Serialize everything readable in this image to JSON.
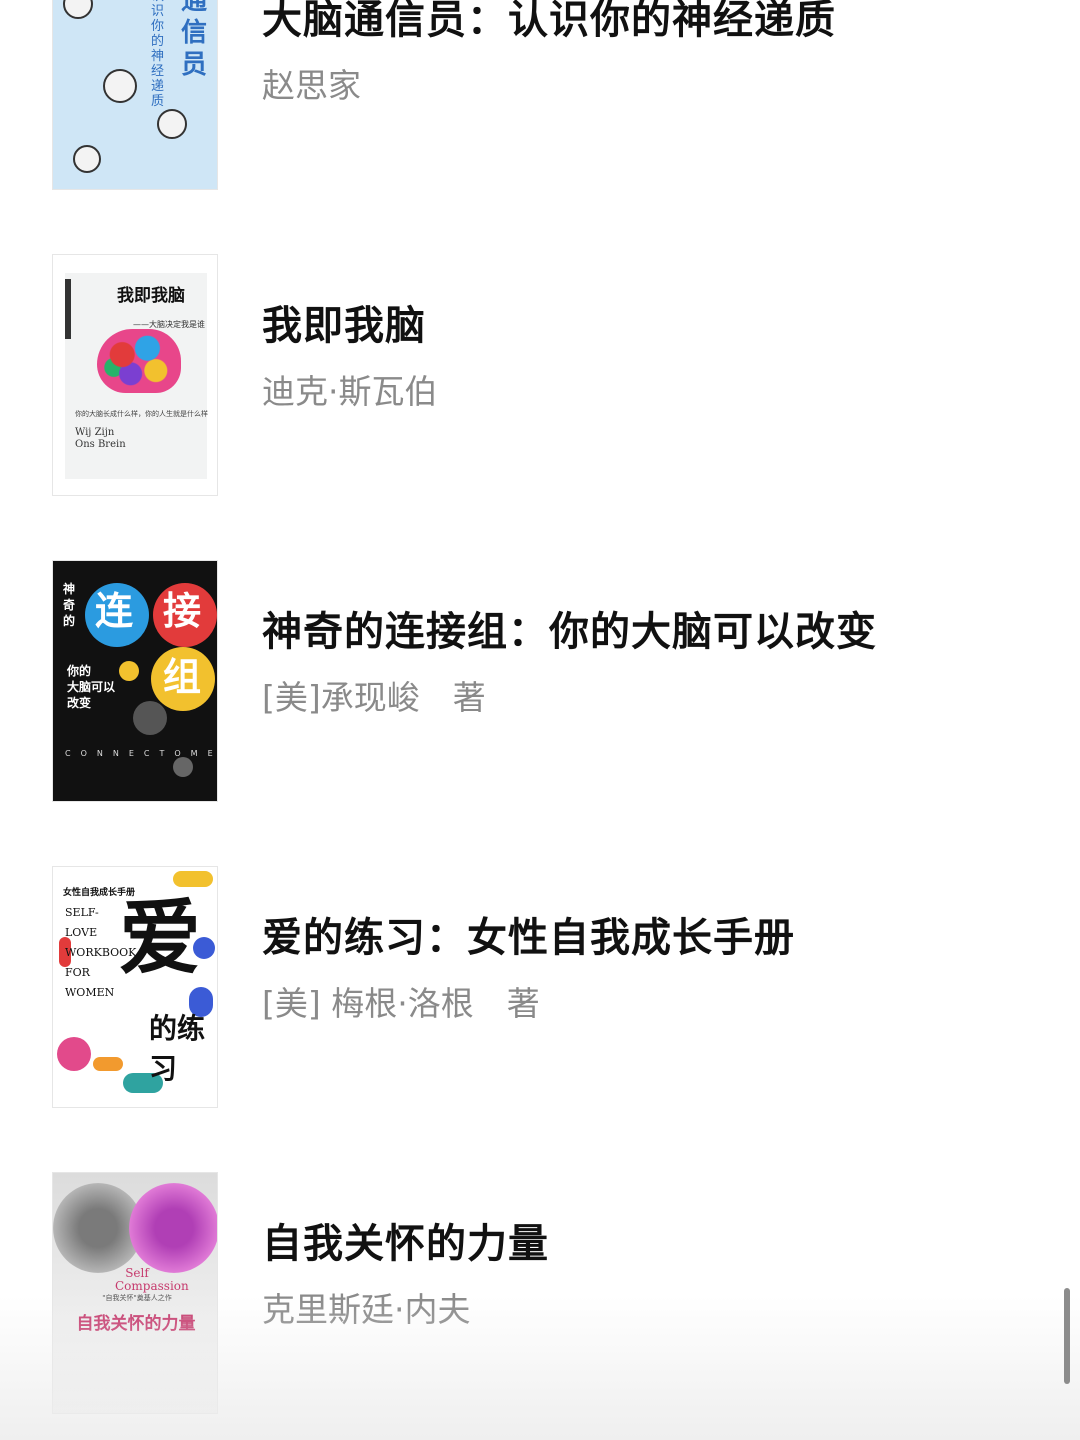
{
  "books": [
    {
      "title": "大脑通信员：认识你的神经递质",
      "author": "赵思家",
      "cover": {
        "vertical_title": "脑通信员",
        "vertical_sub": "认识你的神经递质"
      }
    },
    {
      "title": "我即我脑",
      "author": "迪克·斯瓦伯",
      "cover": {
        "title": "我即我脑",
        "subtitle": "——大脑决定我是谁",
        "en": "Wij Zijn Ons Brein",
        "tagline": "你的大脑长成什么样，你的人生就是什么样"
      }
    },
    {
      "title": "神奇的连接组：你的大脑可以改变",
      "author": "[美]承现峻　著",
      "cover": {
        "vertical": "神奇的",
        "chars": [
          "连",
          "接",
          "组"
        ],
        "line1": "你的",
        "line2": "大脑可以",
        "line3": "改变",
        "en": "CONNECTOME"
      }
    },
    {
      "title": "爱的练习：女性自我成长手册",
      "author": "[美] 梅根·洛根　著",
      "cover": {
        "header": "女性自我成长手册",
        "en": "SELF-LOVE WORKBOOK FOR WOMEN",
        "big": "爱",
        "small": "的练习"
      }
    },
    {
      "title": "自我关怀的力量",
      "author": "克里斯廷·内夫",
      "cover": {
        "en": "Self Compassion",
        "zh": "自我关怀的力量",
        "note": "\"自我关怀\"奠基人之作"
      }
    }
  ],
  "colors": {
    "title": "#111111",
    "author": "#8a8a8a",
    "accent_blue": "#2f6fc0",
    "accent_pink": "#c63a6d"
  }
}
